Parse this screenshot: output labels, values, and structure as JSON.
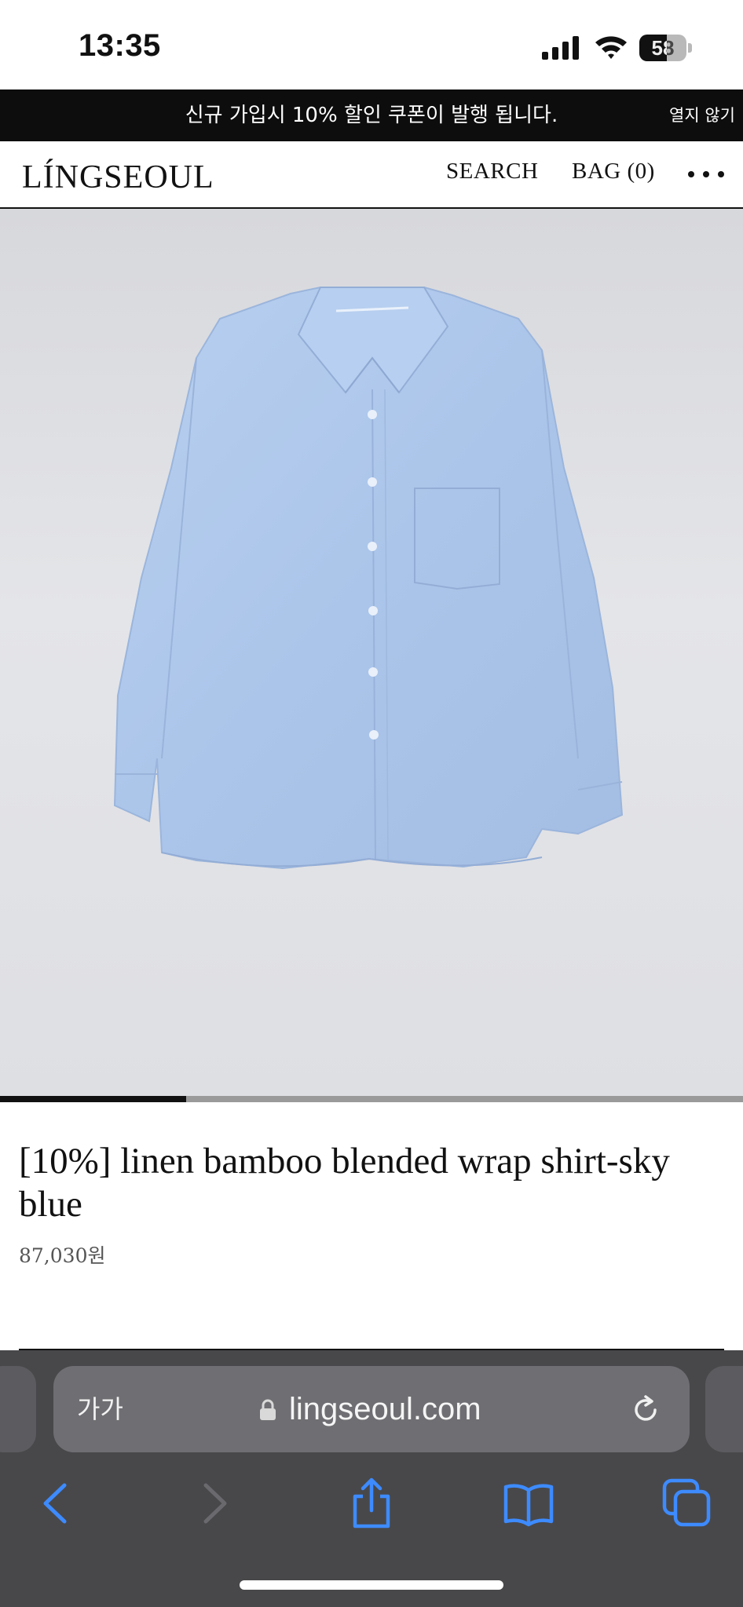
{
  "status_bar": {
    "time": "13:35",
    "battery_level": "58",
    "battery_fraction": 0.58
  },
  "promo_banner": {
    "text": "신규 가입시 10% 할인 쿠폰이 발행 됩니다.",
    "close_label": "열지 않기"
  },
  "site_header": {
    "logo": "LÍNGSEOUL",
    "search_label": "SEARCH",
    "bag_label": "BAG (0)",
    "more_icon": "ellipsis-icon"
  },
  "product": {
    "image_subject": "shirt",
    "gallery_progress": 0.25,
    "title": "[10%] linen bamboo blended wrap shirt-sky blue",
    "price": "87,030원"
  },
  "browser": {
    "text_size_label": "가가",
    "url": "lingseoul.com",
    "lock_icon": "lock-icon",
    "reload_icon": "reload-icon",
    "toolbar": {
      "back_icon": "chevron-left-icon",
      "forward_icon": "chevron-right-icon",
      "share_icon": "share-icon",
      "bookmarks_icon": "book-icon",
      "tabs_icon": "tabs-icon"
    }
  },
  "colors": {
    "browser_accent": "#3d8bff",
    "banner_background": "#0d0d0d",
    "shirt": "#aec8eb"
  }
}
